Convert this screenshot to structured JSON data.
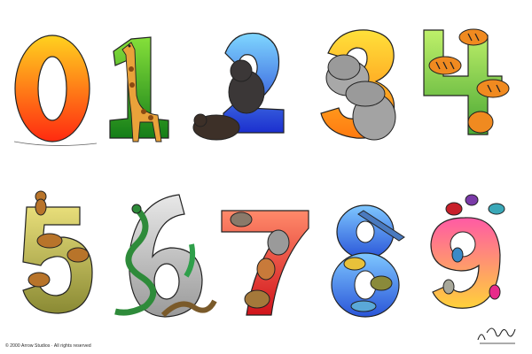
{
  "numerals": [
    {
      "digit": "0",
      "animal": "none",
      "grad": [
        "#ffd21f",
        "#ff2a10"
      ]
    },
    {
      "digit": "1",
      "animal": "giraffe",
      "grad": [
        "#86e03a",
        "#147d18"
      ]
    },
    {
      "digit": "2",
      "animal": "bear",
      "grad": [
        "#7fd7ff",
        "#1b2fcf"
      ]
    },
    {
      "digit": "3",
      "animal": "hippo",
      "grad": [
        "#ffe13a",
        "#ff7a10"
      ]
    },
    {
      "digit": "4",
      "animal": "tiger",
      "grad": [
        "#bff06a",
        "#4aa834"
      ]
    },
    {
      "digit": "5",
      "animal": "monkey",
      "grad": [
        "#e8de7a",
        "#8a8a34"
      ]
    },
    {
      "digit": "6",
      "animal": "snake",
      "grad": [
        "#e8e8e8",
        "#9a9a9a"
      ]
    },
    {
      "digit": "7",
      "animal": "dog",
      "grad": [
        "#ff8a6a",
        "#d1141b"
      ]
    },
    {
      "digit": "8",
      "animal": "fish",
      "grad": [
        "#7ec7ff",
        "#2a55d8"
      ]
    },
    {
      "digit": "9",
      "animal": "bird",
      "grad": [
        "#ff5aa5",
        "#ffd13a"
      ]
    }
  ],
  "copyright": "© 2000 Arrow Studios · All rights reserved",
  "signature_text": "by ArRow"
}
